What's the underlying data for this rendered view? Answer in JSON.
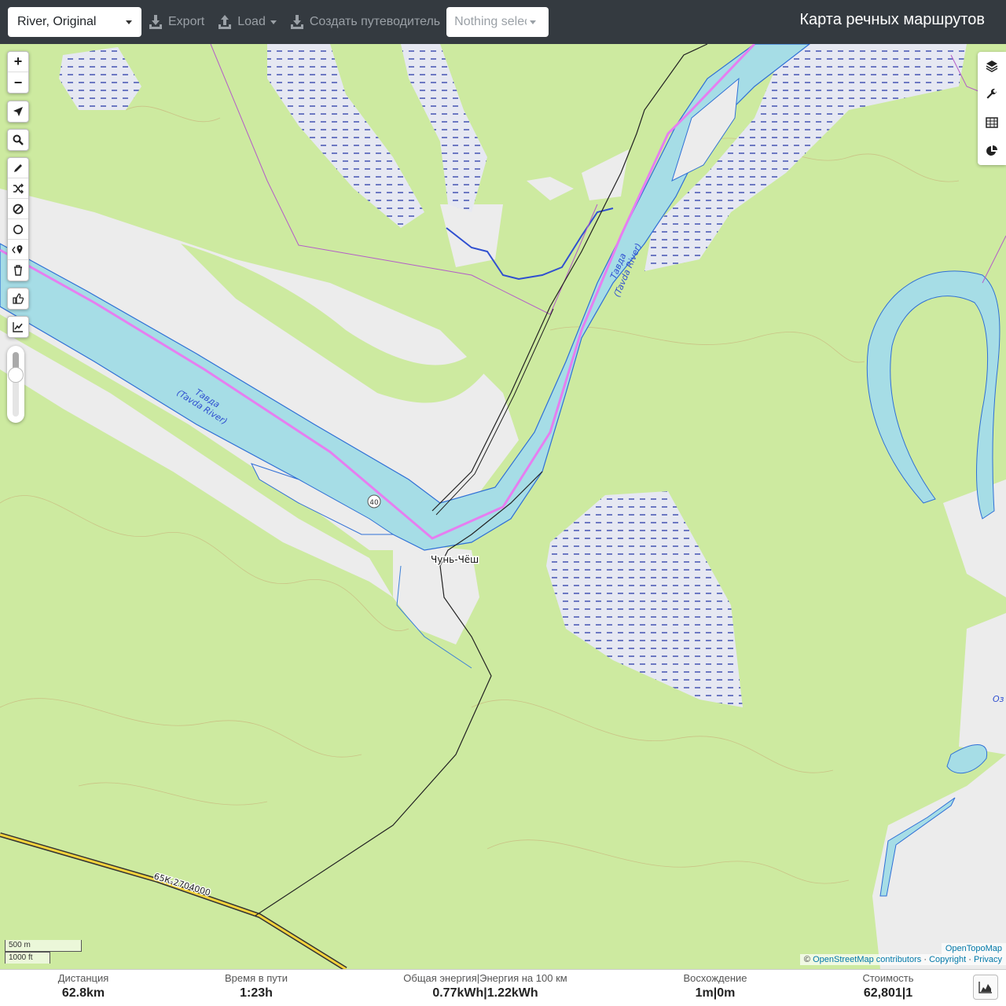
{
  "topbar": {
    "profile": "River, Original",
    "export_label": "Export",
    "load_label": "Load",
    "guide_label": "Создать путеводитель",
    "selection_placeholder": "Nothing selected",
    "app_title": "Карта речных маршрутов"
  },
  "map": {
    "river_name": "Тавда",
    "river_name_en": "(Tavda River)",
    "village": "Чунь-Чёш",
    "road_number": "40",
    "road_ref": "65К-2704000",
    "lake_partial": "Оз",
    "scale_metric": "500 m",
    "scale_imperial": "1000 ft",
    "colors": {
      "land": "#cdeaa0",
      "water": "#a6dde6",
      "route": "#e67ef0",
      "river_edge": "#2f6fd6",
      "bare": "#ececec",
      "wetland_dash": "#2a3ca8"
    }
  },
  "left_controls": {
    "zoom": [
      "+",
      "−"
    ],
    "icons": [
      "locate-icon",
      "search-icon",
      "draw-route-icon",
      "shuffle-icon",
      "nogo-area-icon",
      "circle-icon",
      "poi-marker-icon",
      "delete-icon",
      "thumbs-up-icon",
      "elevation-chart-icon"
    ],
    "opacity_level": 0.3
  },
  "right_controls": {
    "icons": [
      "layers-icon",
      "wrench-icon",
      "table-icon",
      "pie-chart-icon"
    ]
  },
  "attribution": {
    "top": "OpenTopoMap",
    "copyright_symbol": "©",
    "osm": "OpenStreetMap contributors",
    "sep": "·",
    "copyright": "Copyright",
    "privacy": "Privacy"
  },
  "stats": {
    "distance_label": "Дистанция",
    "distance_value": "62.8",
    "distance_unit": "km",
    "time_label": "Время в пути",
    "time_value": "1:23",
    "time_unit": "h",
    "energy_label": "Общая энергия|Энергия на 100 км",
    "energy_total": "0.77",
    "energy_total_unit": "kWh",
    "energy_per100": "1.22",
    "energy_per100_unit": "kWh",
    "ascent_label": "Восхождение",
    "ascent_up": "1",
    "ascent_down": "0",
    "ascent_unit": "m",
    "cost_label": "Стоимость",
    "cost_value": "62,801",
    "cost_count": "1",
    "sep": "|"
  }
}
